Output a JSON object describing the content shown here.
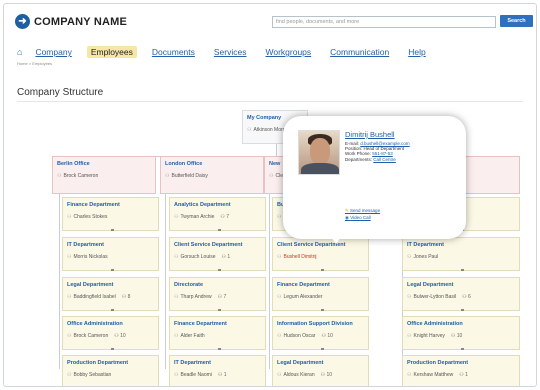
{
  "header": {
    "company": "COMPANY NAME",
    "search_placeholder": "find people, documents, and more",
    "search_button": "Search"
  },
  "nav": {
    "items": [
      "Company",
      "Employees",
      "Documents",
      "Services",
      "Workgroups",
      "Communication",
      "Help"
    ],
    "active": "Employees"
  },
  "breadcrumb": "Home > Employees",
  "page_title": "Company Structure",
  "root": {
    "title": "My Company",
    "person": "Atkinson Morgan"
  },
  "offices": [
    {
      "title": "Berlin Office",
      "person": "Brock Cameron"
    },
    {
      "title": "London Office",
      "person": "Butterfield Daisy"
    },
    {
      "title": "New",
      "person": "Clen"
    },
    {
      "title": "",
      "person": ""
    }
  ],
  "columns": [
    [
      {
        "title": "Finance Department",
        "person": "Charles Stokes",
        "count": ""
      },
      {
        "title": "IT Department",
        "person": "Morris Nickolas",
        "count": ""
      },
      {
        "title": "Legal Department",
        "person": "Baddingfield Isabel",
        "count": "8"
      },
      {
        "title": "Office Administration",
        "person": "Brock Cameron",
        "count": "10"
      },
      {
        "title": "Production Department",
        "person": "Bobby Sebastian",
        "count": ""
      }
    ],
    [
      {
        "title": "Analytics Department",
        "person": "Twyman Archie",
        "count": "7"
      },
      {
        "title": "Client Service Department",
        "person": "Gorsuch Louise",
        "count": "1"
      },
      {
        "title": "Directorate",
        "person": "Tharp Andrew",
        "count": "7"
      },
      {
        "title": "Finance Department",
        "person": "Alder Faith",
        "count": ""
      },
      {
        "title": "IT Department",
        "person": "Beadle Naomi",
        "count": "1"
      }
    ],
    [
      {
        "title": "Bu",
        "person": "",
        "count": ""
      },
      {
        "title": "Client Service Department",
        "person": "Bushell Dimitrij",
        "count": ""
      },
      {
        "title": "Finance Department",
        "person": "Legum Alexander",
        "count": ""
      },
      {
        "title": "Information Support Division",
        "person": "Hudson Oscar",
        "count": "10"
      },
      {
        "title": "Legal Department",
        "person": "Aldous Kieran",
        "count": "10"
      }
    ],
    [
      {
        "title": "",
        "person": "",
        "count": ""
      },
      {
        "title": "IT Department",
        "person": "Jones Paul",
        "count": ""
      },
      {
        "title": "Legal Department",
        "person": "Bulwer-Lytton Basil",
        "count": "6"
      },
      {
        "title": "Office Administration",
        "person": "Knight Harvey",
        "count": "10"
      },
      {
        "title": "Production Department",
        "person": "Kershaw Matthew",
        "count": "1"
      }
    ]
  ],
  "popup": {
    "name": "Dimitrij Bushell",
    "email_label": "E-mail:",
    "email": "d.bushell@example.com",
    "position_label": "Position:",
    "position": "Head of Department",
    "phone_label": "Work Phone:",
    "phone": "551-87-53",
    "dept_label": "Departments:",
    "dept": "Call Centre",
    "send": "Send message",
    "video": "Video Call"
  },
  "colors": {
    "accent": "#1f5ea8",
    "active_tab": "#f6e7a5",
    "office_bg": "#fbeeee",
    "dept_bg": "#fbf8e6"
  }
}
